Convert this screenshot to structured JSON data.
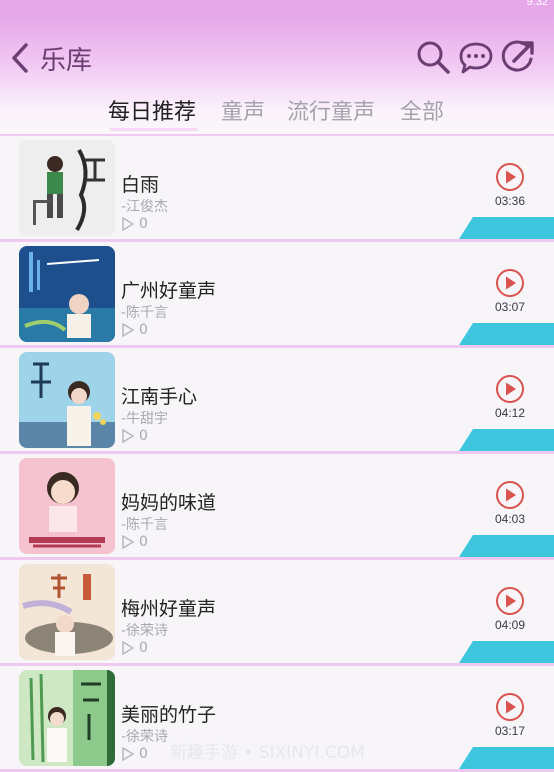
{
  "status": {
    "time": "9:32"
  },
  "header": {
    "title": "乐库"
  },
  "tabs": [
    {
      "label": "每日推荐",
      "active": true
    },
    {
      "label": "童声",
      "active": false
    },
    {
      "label": "流行童声",
      "active": false
    },
    {
      "label": "全部",
      "active": false
    }
  ],
  "songs": [
    {
      "title": "白雨",
      "artist": "-江俊杰",
      "plays": "0",
      "duration": "03:36"
    },
    {
      "title": "广州好童声",
      "artist": "-陈千言",
      "plays": "0",
      "duration": "03:07"
    },
    {
      "title": "江南手心",
      "artist": "-牛甜宇",
      "plays": "0",
      "duration": "04:12"
    },
    {
      "title": "妈妈的味道",
      "artist": "-陈千言",
      "plays": "0",
      "duration": "04:03"
    },
    {
      "title": "梅州好童声",
      "artist": "-徐荣诗",
      "plays": "0",
      "duration": "04:09"
    },
    {
      "title": "美丽的竹子",
      "artist": "-徐荣诗",
      "plays": "0",
      "duration": "03:17"
    }
  ],
  "watermark": "新趣手游 • SIXINYI.COM",
  "colors": {
    "accent": "#d9534f",
    "tag": "#3fc6df",
    "header": "#e39ee8",
    "title": "#6b3d73"
  }
}
